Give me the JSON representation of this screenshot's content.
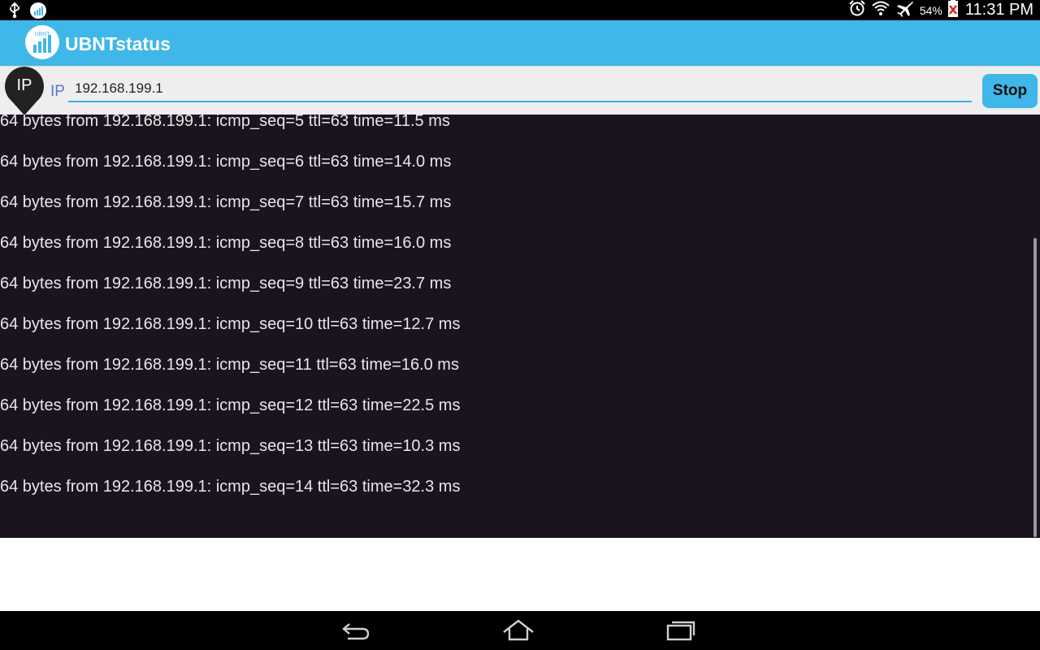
{
  "status_bar": {
    "battery_percent": "54%",
    "time": "11:31 PM",
    "icons": [
      "usb-icon",
      "app-notification-icon",
      "alarm-icon",
      "wifi-icon",
      "airplane-icon",
      "battery-icon"
    ]
  },
  "action_bar": {
    "title": "UBNTstatus",
    "logo_text": "UBNT"
  },
  "ip_row": {
    "marker_label": "IP",
    "field_label": "IP",
    "ip_value": "192.168.199.1",
    "stop_label": "Stop"
  },
  "output": {
    "lines": [
      "64 bytes from 192.168.199.1: icmp_seq=5 ttl=63 time=11.5 ms",
      "64 bytes from 192.168.199.1: icmp_seq=6 ttl=63 time=14.0 ms",
      "64 bytes from 192.168.199.1: icmp_seq=7 ttl=63 time=15.7 ms",
      "64 bytes from 192.168.199.1: icmp_seq=8 ttl=63 time=16.0 ms",
      "64 bytes from 192.168.199.1: icmp_seq=9 ttl=63 time=23.7 ms",
      "64 bytes from 192.168.199.1: icmp_seq=10 ttl=63 time=12.7 ms",
      "64 bytes from 192.168.199.1: icmp_seq=11 ttl=63 time=16.0 ms",
      "64 bytes from 192.168.199.1: icmp_seq=12 ttl=63 time=22.5 ms",
      "64 bytes from 192.168.199.1: icmp_seq=13 ttl=63 time=10.3 ms",
      "64 bytes from 192.168.199.1: icmp_seq=14 ttl=63 time=32.3 ms"
    ]
  },
  "nav_bar": {
    "icons": [
      "back-icon",
      "home-icon",
      "recent-apps-icon"
    ]
  },
  "colors": {
    "accent": "#3fb7e8",
    "output_background": "#1b1420",
    "output_text": "#e8e6ea",
    "ip_label": "#5a78d0"
  }
}
